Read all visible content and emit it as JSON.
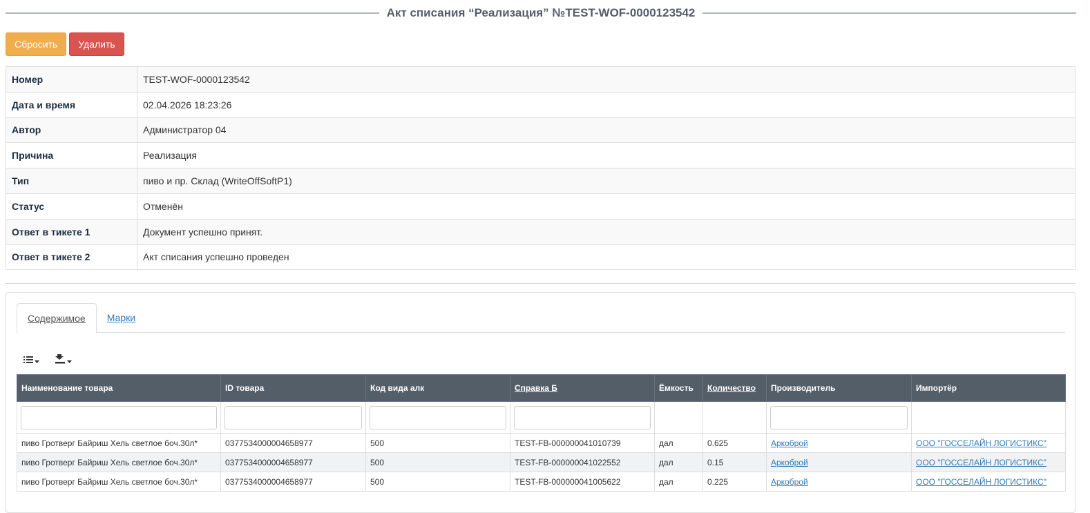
{
  "page": {
    "title": "Акт списания “Реализация” №TEST-WOF-0000123542"
  },
  "toolbar": {
    "reset_label": "Сбросить",
    "delete_label": "Удалить"
  },
  "info": [
    {
      "label": "Номер",
      "value": "TEST-WOF-0000123542"
    },
    {
      "label": "Дата и время",
      "value": "02.04.2026 18:23:26"
    },
    {
      "label": "Автор",
      "value": "Администратор 04"
    },
    {
      "label": "Причина",
      "value": "Реализация"
    },
    {
      "label": "Тип",
      "value": "пиво и пр. Склад (WriteOffSoftP1)"
    },
    {
      "label": "Статус",
      "value": "Отменён"
    },
    {
      "label": "Ответ в тикете 1",
      "value": "Документ успешно принят."
    },
    {
      "label": "Ответ в тикете 2",
      "value": "Акт списания успешно проведен"
    }
  ],
  "tabs": [
    {
      "label": "Содержимое",
      "active": true
    },
    {
      "label": "Марки",
      "active": false
    }
  ],
  "icons": {
    "columns": "list-icon",
    "export": "export-icon",
    "dropdown": "caret-down-icon"
  },
  "grid": {
    "columns": [
      {
        "label": "Наименование товара",
        "sortable": false
      },
      {
        "label": "ID товара",
        "sortable": false
      },
      {
        "label": "Код вида алк",
        "sortable": false
      },
      {
        "label": "Справка Б",
        "sortable": true
      },
      {
        "label": "Ёмкость",
        "sortable": false
      },
      {
        "label": "Количество",
        "sortable": true
      },
      {
        "label": "Производитель",
        "sortable": false
      },
      {
        "label": "Импортёр",
        "sortable": false
      }
    ],
    "rows": [
      [
        "пиво Гротверг Байриш Хель светлое боч.30л*",
        "0377534000004658977",
        "500",
        "TEST-FB-000000041010739",
        "дал",
        "0.625",
        "Аркоброй",
        "ООО \"ГОССЕЛАЙН ЛОГИСТИКС\""
      ],
      [
        "пиво Гротверг Байриш Хель светлое боч.30л*",
        "0377534000004658977",
        "500",
        "TEST-FB-000000041022552",
        "дал",
        "0.15",
        "Аркоброй",
        "ООО \"ГОССЕЛАЙН ЛОГИСТИКС\""
      ],
      [
        "пиво Гротверг Байриш Хель светлое боч.30л*",
        "0377534000004658977",
        "500",
        "TEST-FB-000000041005622",
        "дал",
        "0.225",
        "Аркоброй",
        "ООО \"ГОССЕЛАЙН ЛОГИСТИКС\""
      ]
    ]
  },
  "colors": {
    "reset": "#f0ad4e",
    "delete": "#d9534f",
    "header": "#545e69",
    "link": "#337ab7"
  }
}
